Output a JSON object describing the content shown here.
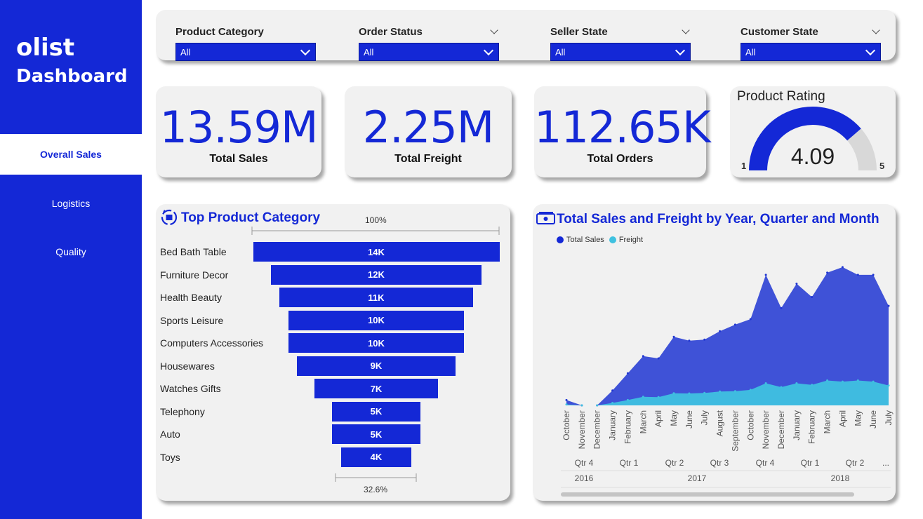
{
  "sidebar": {
    "logo": "olist",
    "subtitle": "Dashboard",
    "items": [
      {
        "label": "Overall Sales",
        "active": true
      },
      {
        "label": "Logistics",
        "active": false
      },
      {
        "label": "Quality",
        "active": false
      }
    ]
  },
  "filters": [
    {
      "label": "Product Category",
      "value": "All"
    },
    {
      "label": "Order Status",
      "value": "All"
    },
    {
      "label": "Seller State",
      "value": "All"
    },
    {
      "label": "Customer State",
      "value": "All"
    }
  ],
  "kpis": [
    {
      "value": "13.59M",
      "label": "Total Sales"
    },
    {
      "value": "2.25M",
      "label": "Total Freight"
    },
    {
      "value": "112.65K",
      "label": "Total Orders"
    }
  ],
  "rating": {
    "title": "Product Rating",
    "value": "4.09",
    "min": "1",
    "max": "5",
    "level": 4.09
  },
  "colors": {
    "accent": "#1428d6",
    "freight": "#3fc1e0",
    "card": "#f1f1f1"
  },
  "funnel": {
    "title": "Top Product Category",
    "top_pct": "100%",
    "bottom_pct": "32.6%",
    "icon": "recycle-box-icon"
  },
  "trend": {
    "title": "Total Sales and Freight by Year, Quarter and Month",
    "icon": "money-icon",
    "legend": [
      "Total Sales",
      "Freight"
    ],
    "quarters": [
      "Qtr 4",
      "Qtr 1",
      "Qtr 2",
      "Qtr 3",
      "Qtr 4",
      "Qtr 1",
      "Qtr 2",
      "..."
    ],
    "years": [
      "2016",
      "2017",
      "2018"
    ]
  },
  "chart_data": [
    {
      "type": "bar",
      "title": "Top Product Category",
      "categories": [
        "Bed Bath Table",
        "Furniture Decor",
        "Health Beauty",
        "Sports Leisure",
        "Computers Accessories",
        "Housewares",
        "Watches Gifts",
        "Telephony",
        "Auto",
        "Toys"
      ],
      "values": [
        14000,
        12000,
        11000,
        10000,
        10000,
        9000,
        7000,
        5000,
        5000,
        4000
      ],
      "labels": [
        "14K",
        "12K",
        "11K",
        "10K",
        "10K",
        "9K",
        "7K",
        "5K",
        "5K",
        "4K"
      ]
    },
    {
      "type": "area",
      "title": "Total Sales and Freight by Year, Quarter and Month",
      "x": [
        "October",
        "November",
        "December",
        "January",
        "February",
        "March",
        "April",
        "May",
        "June",
        "July",
        "August",
        "September",
        "October",
        "November",
        "December",
        "January",
        "February",
        "March",
        "April",
        "May",
        "June",
        "July"
      ],
      "series": [
        {
          "name": "Total Sales",
          "values": [
            48000,
            10,
            20,
            135000,
            290000,
            445000,
            425000,
            620000,
            585000,
            595000,
            670000,
            730000,
            780000,
            1180000,
            880000,
            1100000,
            980000,
            1200000,
            1250000,
            1180000,
            1180000,
            900000
          ]
        },
        {
          "name": "Freight",
          "values": [
            9000,
            0,
            5,
            22000,
            48000,
            78000,
            75000,
            110000,
            108000,
            112000,
            125000,
            128000,
            140000,
            200000,
            165000,
            200000,
            185000,
            225000,
            215000,
            225000,
            215000,
            180000
          ]
        }
      ],
      "ylim": [
        0,
        1300000
      ]
    }
  ]
}
